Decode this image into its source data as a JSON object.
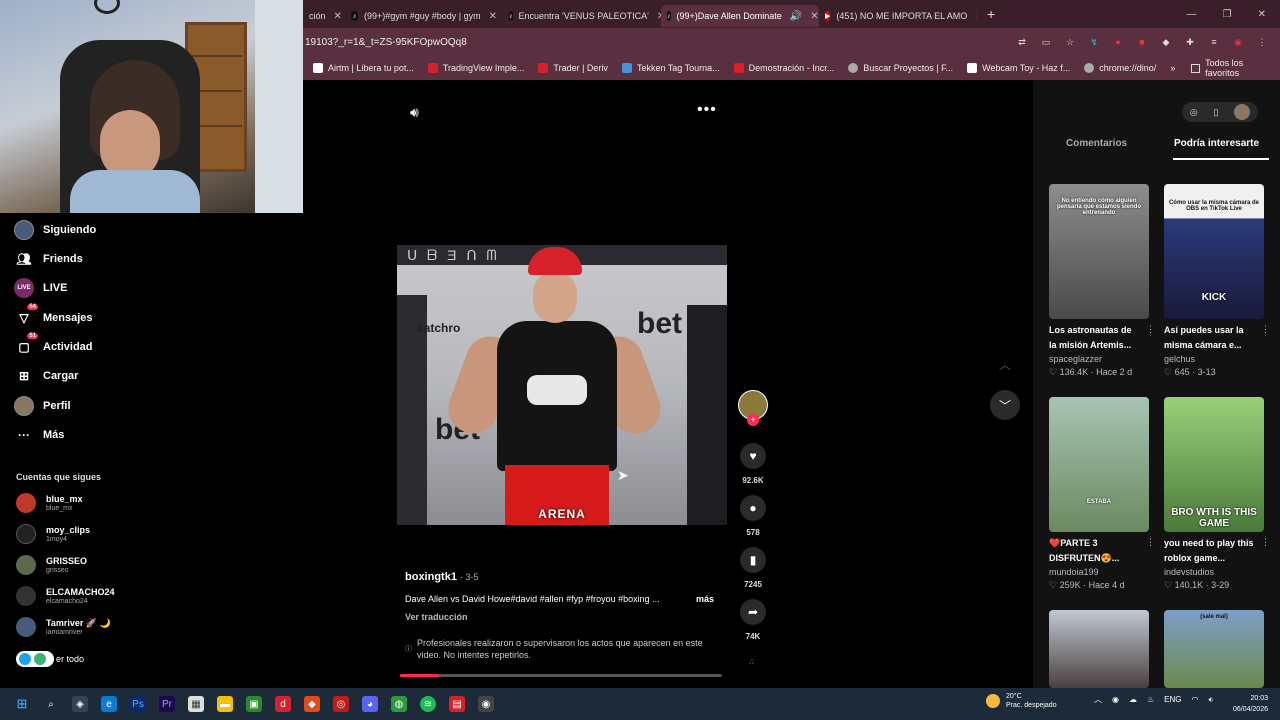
{
  "browser": {
    "tabs": [
      {
        "label": "ción",
        "active": false,
        "icon": "tiktok-icon",
        "close": ""
      },
      {
        "label": "(99+)#gym #guy #body | gym",
        "active": false,
        "icon": "tiktok-icon",
        "close": "✕"
      },
      {
        "label": "Encuentra 'VENUS PALEOTICA'",
        "active": false,
        "icon": "tiktok-icon",
        "close": "✕"
      },
      {
        "label": "(99+)Dave Allen Dominate",
        "active": true,
        "icon": "tiktok-icon",
        "close": "✕"
      },
      {
        "label": "(451) NO ME IMPORTA EL AMO",
        "active": false,
        "icon": "youtube-icon",
        "close": "✕"
      }
    ],
    "url": "19103?_r=1&_t=ZS-95KFOpwOQq8",
    "bookmarks": [
      {
        "label": "Airtm | Libera tu pot...",
        "color": "#ffffff"
      },
      {
        "label": "TradingView Imple...",
        "color": "#d6202a"
      },
      {
        "label": "Trader | Deriv",
        "color": "#d6202a"
      },
      {
        "label": "Tekken Tag Tourna...",
        "color": "#4a90d9"
      },
      {
        "label": "Demostración - Incr...",
        "color": "#d6202a"
      },
      {
        "label": "Buscar Proyectos | F...",
        "color": "#aaaaaa"
      },
      {
        "label": "Webcam Toy - Haz f...",
        "color": "#ffffff"
      },
      {
        "label": "chrome://dino/",
        "color": "#aaaaaa"
      }
    ],
    "bookmarks_all": "Todos los favoritos"
  },
  "nav": {
    "items": [
      {
        "label": "Siguiendo",
        "icon": "avatar-icon",
        "badge": ""
      },
      {
        "label": "Friends",
        "icon": "friends-icon",
        "badge": ""
      },
      {
        "label": "LIVE",
        "icon": "live-icon",
        "badge": ""
      },
      {
        "label": "Mensajes",
        "icon": "messages-icon",
        "badge": "54"
      },
      {
        "label": "Actividad",
        "icon": "activity-icon",
        "badge": "51"
      },
      {
        "label": "Cargar",
        "icon": "upload-icon",
        "badge": ""
      },
      {
        "label": "Perfil",
        "icon": "profile-icon",
        "badge": ""
      },
      {
        "label": "Más",
        "icon": "more-icon",
        "badge": ""
      }
    ],
    "following_title": "Cuentas que sigues",
    "following": [
      {
        "name": "blue_mx",
        "handle": "blue_mx",
        "color": "#c0392b"
      },
      {
        "name": "moy_clips",
        "handle": "1moy4",
        "color": "#222222"
      },
      {
        "name": "GRISSEO",
        "handle": "grisseo",
        "color": "#5a6a4a"
      },
      {
        "name": "ELCAMACHO24",
        "handle": "elcamacho24",
        "color": "#333333"
      },
      {
        "name": "Tamriver 🚀 🌙",
        "handle": "iamtamriver",
        "color": "#4a5a7a"
      }
    ],
    "see_all": "er todo"
  },
  "video": {
    "caption": "ARENA",
    "left_sign": "aatchro",
    "bet_label": "bet",
    "username": "boxingtk1",
    "date": "· 3-5",
    "description": "Dave Allen vs David Howe#david #allen #fyp #froyou #boxing ...",
    "more": "más",
    "translate": "Ver traducción",
    "warning": "Profesionales realizaron o supervisaron los actos que aparecen en este video. No intentes repetirlos.",
    "progress": 0.12,
    "likes": "92.6K",
    "comments": "578",
    "saves": "7245",
    "shares": "74K"
  },
  "panel": {
    "tab_comments": "Comentarios",
    "tab_suggested": "Podría interesarte",
    "cards": [
      {
        "title": "Los astronautas de la misión Artemis...",
        "user": "spaceglazzer",
        "likes": "136.4K",
        "when": "Hace 2 d",
        "thumb_text": "No entiendo cómo alguien pensaría que estamos siendo entrenando",
        "color": "#6a6a6a"
      },
      {
        "title": "Así puedes usar la misma cámara e...",
        "user": "gelchus",
        "likes": "645",
        "when": "3-13",
        "thumb_text": "Cómo usar la misma cámara de OBS en TikTok Live",
        "big": "KICK",
        "color": "#2a2a4a"
      },
      {
        "title": "❤️PARTE 3 DISFRUTEN😍...",
        "user": "mundoia199",
        "likes": "259K",
        "when": "Hace 4 d",
        "thumb_text": "ESTABA",
        "color": "#8fb0a0"
      },
      {
        "title": "you need to play this roblox game...",
        "user": "indevstudios",
        "likes": "140.1K",
        "when": "3-29",
        "thumb_text": "BRO WTH IS THIS GAME",
        "color": "#7ab86a"
      },
      {
        "title": "",
        "user": "",
        "likes": "",
        "when": "",
        "thumb_text": "",
        "color": "#a0a8b0"
      },
      {
        "title": "",
        "user": "",
        "likes": "",
        "when": "",
        "thumb_text": "(sale mal)",
        "color": "#7ba0c8"
      }
    ]
  },
  "taskbar": {
    "temp": "20°C",
    "weather": "Prac. despejado",
    "lang": "ENG",
    "time": "20:03",
    "date": "06/04/2026"
  }
}
